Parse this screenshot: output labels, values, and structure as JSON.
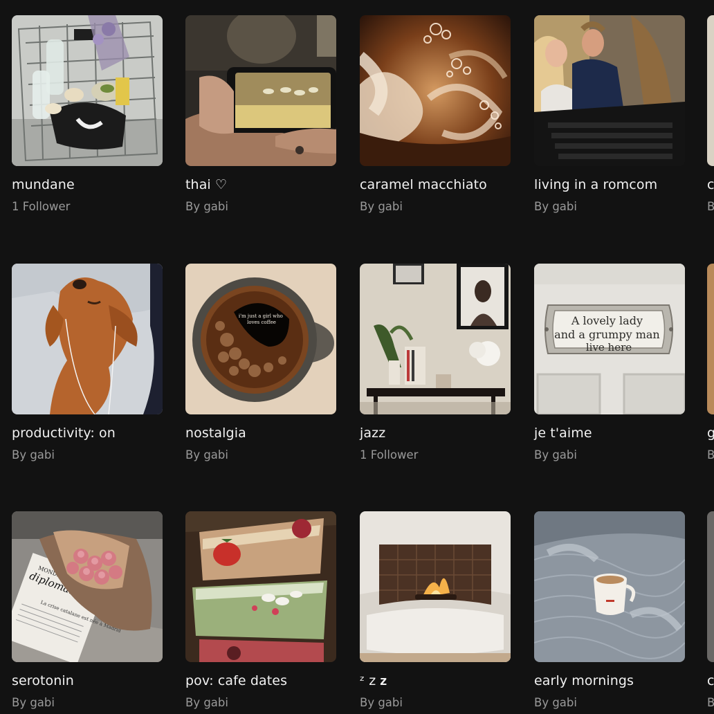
{
  "boards": [
    {
      "title": "mundane",
      "subtitle": "1 Follower"
    },
    {
      "title": "thai ♡",
      "subtitle": "By gabi"
    },
    {
      "title": "caramel macchiato",
      "subtitle": "By gabi"
    },
    {
      "title": "living in a romcom",
      "subtitle": "By gabi"
    },
    {
      "title": "productivity: on",
      "subtitle": "By gabi"
    },
    {
      "title": "nostalgia",
      "subtitle": "By gabi"
    },
    {
      "title": "jazz",
      "subtitle": "1 Follower"
    },
    {
      "title": "je t'aime",
      "subtitle": "By gabi"
    },
    {
      "title": "serotonin",
      "subtitle": "By gabi"
    },
    {
      "title": "pov: cafe dates",
      "subtitle": "By gabi"
    },
    {
      "title": "ᶻ z 𝐳",
      "subtitle": "By gabi"
    },
    {
      "title": "early mornings",
      "subtitle": "By gabi"
    }
  ],
  "partial_boards": [
    {
      "title": "c",
      "subtitle": "B"
    },
    {
      "title": "g",
      "subtitle": "B"
    },
    {
      "title": "c",
      "subtitle": "B"
    }
  ],
  "image_text": {
    "coffee_foam": "i'm just a girl who loves coffee",
    "plaque": [
      "A lovely lady",
      "and a grumpy man",
      "live here"
    ],
    "newspaper_masthead": "diplomatique",
    "newspaper_top": "MONDE",
    "newspaper_headline": "La crise catalane est née à Madrid"
  },
  "colors": {
    "background": "#121212",
    "title": "#f2f2f2",
    "subtitle": "#9a9a9a"
  }
}
